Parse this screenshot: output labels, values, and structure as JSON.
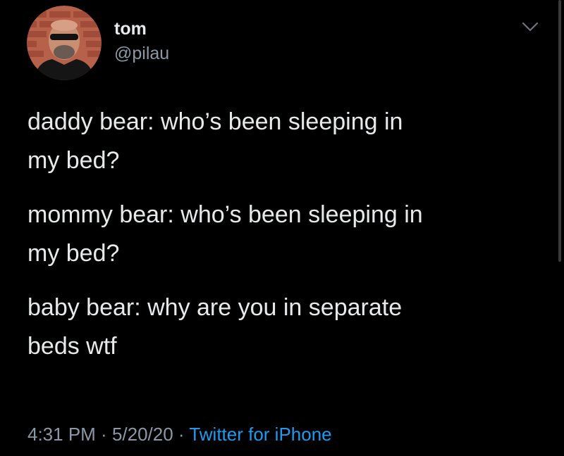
{
  "author": {
    "display_name": "tom",
    "handle": "@pilau"
  },
  "tweet": {
    "lines": [
      "daddy bear: who’s been sleeping in\nmy bed?",
      "mommy bear: who’s been sleeping in\nmy bed?",
      "baby bear: why are you in separate\nbeds wtf"
    ]
  },
  "meta": {
    "time": "4:31 PM",
    "separator": " · ",
    "date": "5/20/20",
    "source": "Twitter for iPhone"
  },
  "icons": {
    "menu": "chevron-down-icon"
  },
  "colors": {
    "background": "#000000",
    "text_primary": "#e7e9ea",
    "text_secondary": "#8b98a5",
    "link": "#1d9bf0"
  }
}
